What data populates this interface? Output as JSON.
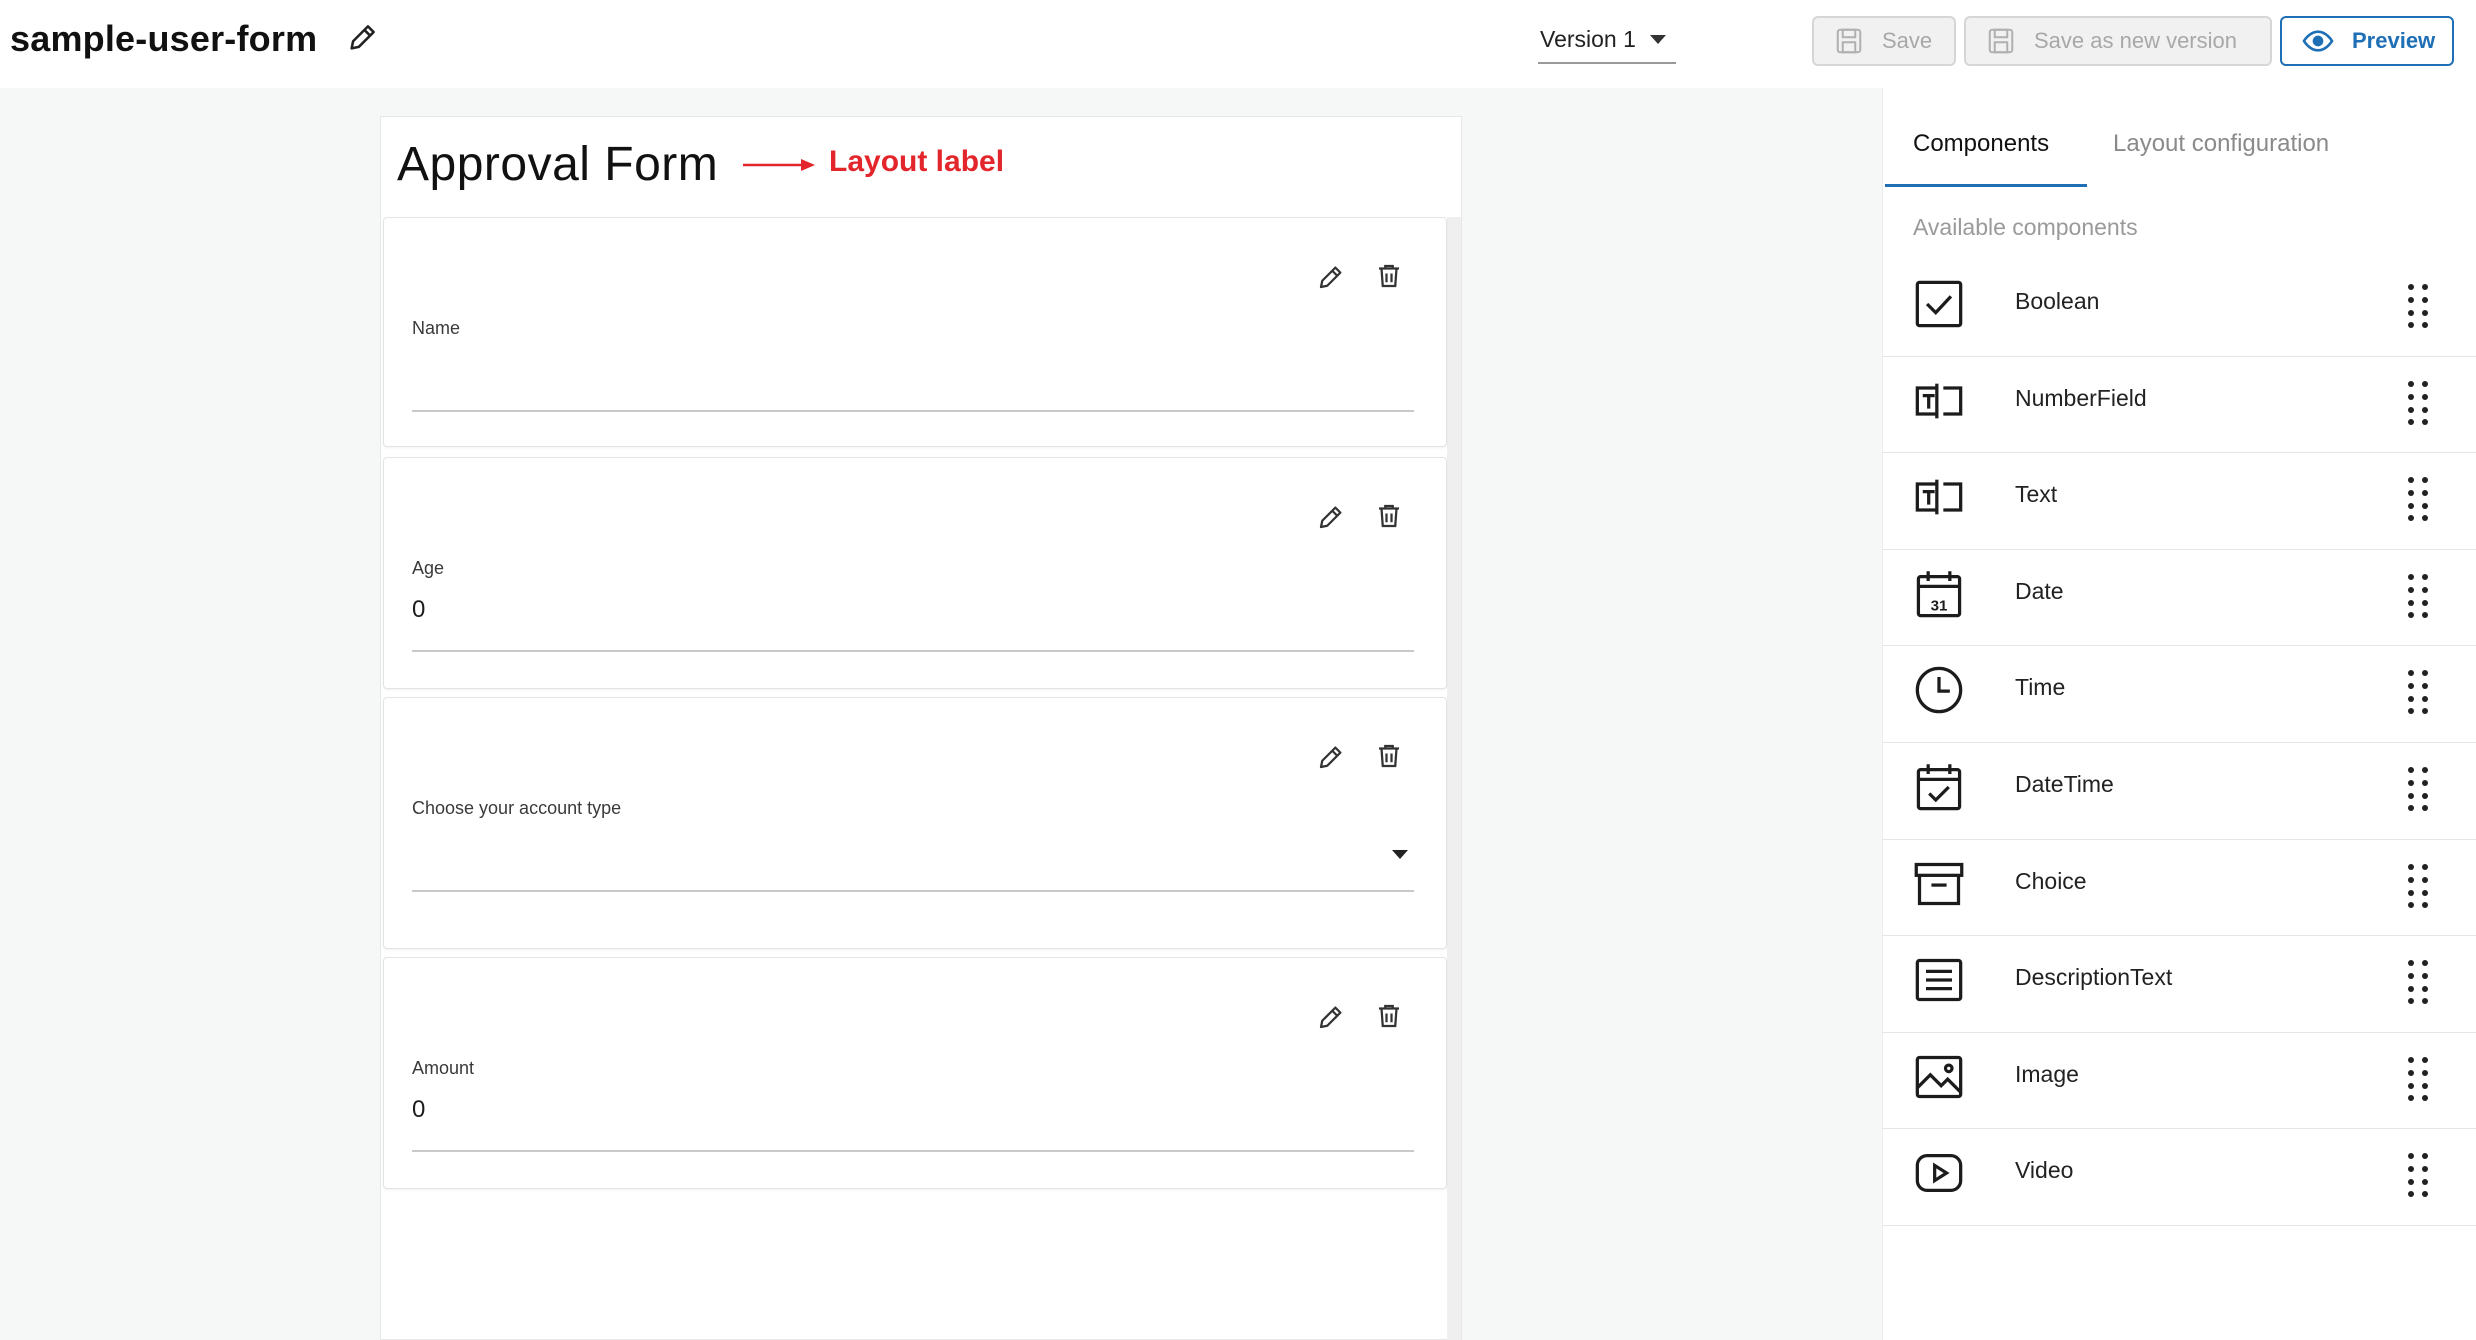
{
  "header": {
    "title": "sample-user-form",
    "edit_icon": "pencil-icon",
    "version_label": "Version 1",
    "save_label": "Save",
    "save_new_label": "Save as new version",
    "preview_label": "Preview",
    "accent_color": "#1e6fb5"
  },
  "form": {
    "title": "Approval Form",
    "annotation_label": "Layout label",
    "annotation_color": "#e3262b",
    "fields": [
      {
        "label": "Name",
        "value": "",
        "type": "text"
      },
      {
        "label": "Age",
        "value": "0",
        "type": "number"
      },
      {
        "label": "Choose your account type",
        "value": "",
        "type": "select"
      },
      {
        "label": "Amount",
        "value": "0",
        "type": "number"
      }
    ]
  },
  "panel": {
    "tabs": [
      {
        "label": "Components",
        "active": true
      },
      {
        "label": "Layout configuration",
        "active": false
      }
    ],
    "section_title": "Available components",
    "components": [
      {
        "label": "Boolean",
        "icon": "checkbox-icon"
      },
      {
        "label": "NumberField",
        "icon": "text-field-icon"
      },
      {
        "label": "Text",
        "icon": "text-field-icon"
      },
      {
        "label": "Date",
        "icon": "calendar-icon"
      },
      {
        "label": "Time",
        "icon": "clock-icon"
      },
      {
        "label": "DateTime",
        "icon": "calendar-check-icon"
      },
      {
        "label": "Choice",
        "icon": "archive-box-icon"
      },
      {
        "label": "DescriptionText",
        "icon": "text-lines-icon"
      },
      {
        "label": "Image",
        "icon": "image-icon"
      },
      {
        "label": "Video",
        "icon": "video-play-icon"
      }
    ]
  }
}
